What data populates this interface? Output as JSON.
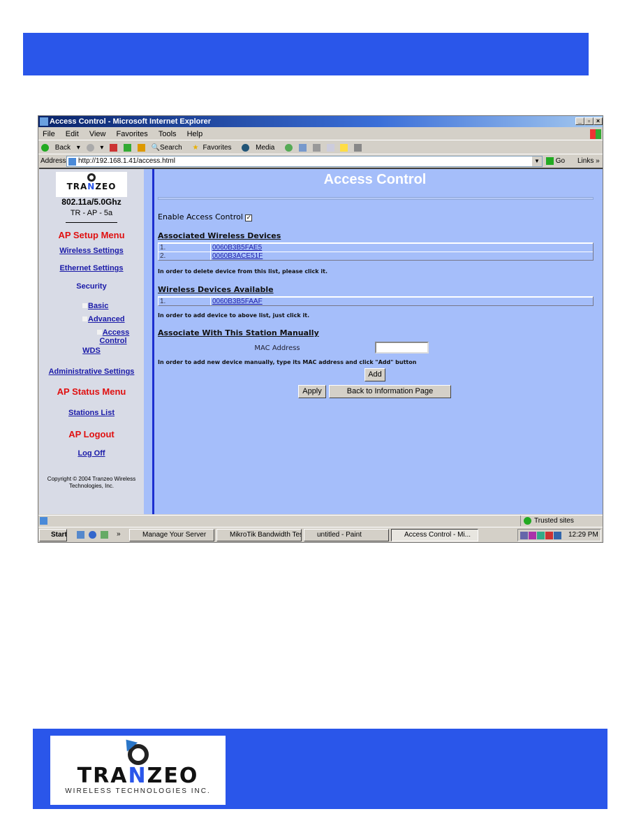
{
  "browser": {
    "title": "Access Control - Microsoft Internet Explorer",
    "menu": [
      "File",
      "Edit",
      "View",
      "Favorites",
      "Tools",
      "Help"
    ],
    "toolbar": {
      "back": "Back",
      "search": "Search",
      "favorites": "Favorites",
      "media": "Media"
    },
    "address_label": "Address",
    "address_value": "http://192.168.1.41/access.html",
    "go_label": "Go",
    "links_label": "Links",
    "status_zone": "Trusted sites"
  },
  "sidebar": {
    "brand": "TRANZEO",
    "model_line1": "802.11a/5.0Ghz",
    "model_line2": "TR - AP - 5a",
    "setup_menu": "AP Setup Menu",
    "wireless_settings": "Wireless Settings",
    "ethernet_settings": "Ethernet Settings",
    "security": "Security",
    "basic": "Basic",
    "advanced": "Advanced",
    "access_control": "Access Control",
    "wds": "WDS",
    "admin_settings": "Administrative Settings",
    "status_menu": "AP Status Menu",
    "stations_list": "Stations List",
    "logout_menu": "AP Logout",
    "log_off": "Log Off",
    "copyright": "Copyright © 2004 Tranzeo Wireless Technologies, Inc."
  },
  "main": {
    "title": "Access Control",
    "enable_label": "Enable Access Control",
    "enable_checked": true,
    "associated_heading": "Associated Wireless Devices",
    "associated": [
      {
        "num": "1.",
        "mac": "0060B3B5FAE5"
      },
      {
        "num": "2.",
        "mac": "0060B3ACE51F"
      }
    ],
    "associated_note": "In order to delete device from this list, please click it.",
    "available_heading": "Wireless Devices Available",
    "available": [
      {
        "num": "1.",
        "mac": "0060B3B5FAAF"
      }
    ],
    "available_note": "In order to add device to above list, just click it.",
    "manual_heading": "Associate With This Station Manually",
    "mac_label": "MAC Address",
    "mac_value": "",
    "manual_note": "In order to add new device manually, type its MAC address and click \"Add\" button",
    "add_label": "Add",
    "apply_label": "Apply",
    "back_label": "Back to Information Page"
  },
  "taskbar": {
    "start": "Start",
    "tasks": [
      "Manage Your Server",
      "MikroTik Bandwidth Test...",
      "untitled - Paint",
      "Access Control - Mi..."
    ],
    "clock": "12:29 PM"
  },
  "footer": {
    "logo_brand": "TRANZEO",
    "logo_tagline": "WIRELESS TECHNOLOGIES INC."
  },
  "colors": {
    "banner": "#2a56ea",
    "content_bg": "#a5befa",
    "menu_red": "#e01010",
    "link": "#1a1aa8"
  }
}
